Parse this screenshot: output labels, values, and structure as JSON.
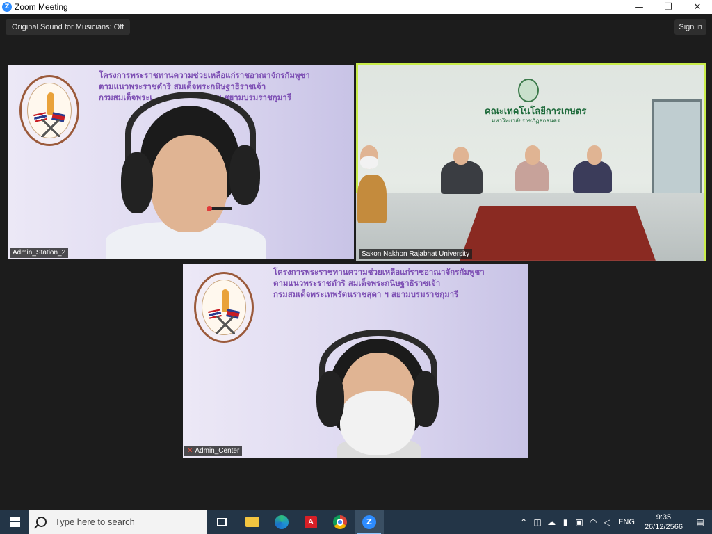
{
  "window": {
    "title": "Zoom Meeting",
    "app_icon": "Z"
  },
  "window_controls": {
    "minimize": "—",
    "restore": "❐",
    "close": "✕"
  },
  "meeting": {
    "sound_button": "Original Sound for Musicians: Off",
    "signin_button": "Sign in"
  },
  "tiles": {
    "station2": {
      "name": "Admin_Station_2",
      "banner": [
        "โครงการพระราชทานความช่วยเหลือแก่ราชอาณาจักรกัมพูชา",
        "ตามแนวพระราชดำริ สมเด็จพระกนิษฐาธิราชเจ้า",
        "กรมสมเด็จพระเ",
        "ฯ สยามบรมราชกุมารี"
      ]
    },
    "university": {
      "name": "Sakon Nakhon Rajabhat University",
      "wall_title": "คณะเทคโนโลยีการเกษตร",
      "wall_subtitle": "มหาวิทยาลัยราชภัฏสกลนคร"
    },
    "center": {
      "name": "Admin_Center",
      "muted": true,
      "banner": [
        "โครงการพระราชทานความช่วยเหลือแก่ราชอาณาจักรกัมพูชา",
        "ตามแนวพระราชดำริ สมเด็จพระกนิษฐาธิราชเจ้า",
        "กรมสมเด็จพระเทพรัตนราชสุดา ฯ สยามบรมราชกุมารี"
      ]
    }
  },
  "taskbar": {
    "search_placeholder": "Type here to search",
    "apps": [
      "task-view",
      "file-explorer",
      "edge",
      "adobe-acrobat",
      "chrome",
      "zoom"
    ],
    "tray": {
      "language": "ENG",
      "time": "9:35",
      "date": "26/12/2566"
    }
  },
  "colors": {
    "active_speaker_outline": "#c8ec4a",
    "banner_text": "#7d4fb4",
    "taskbar": "#233547"
  }
}
